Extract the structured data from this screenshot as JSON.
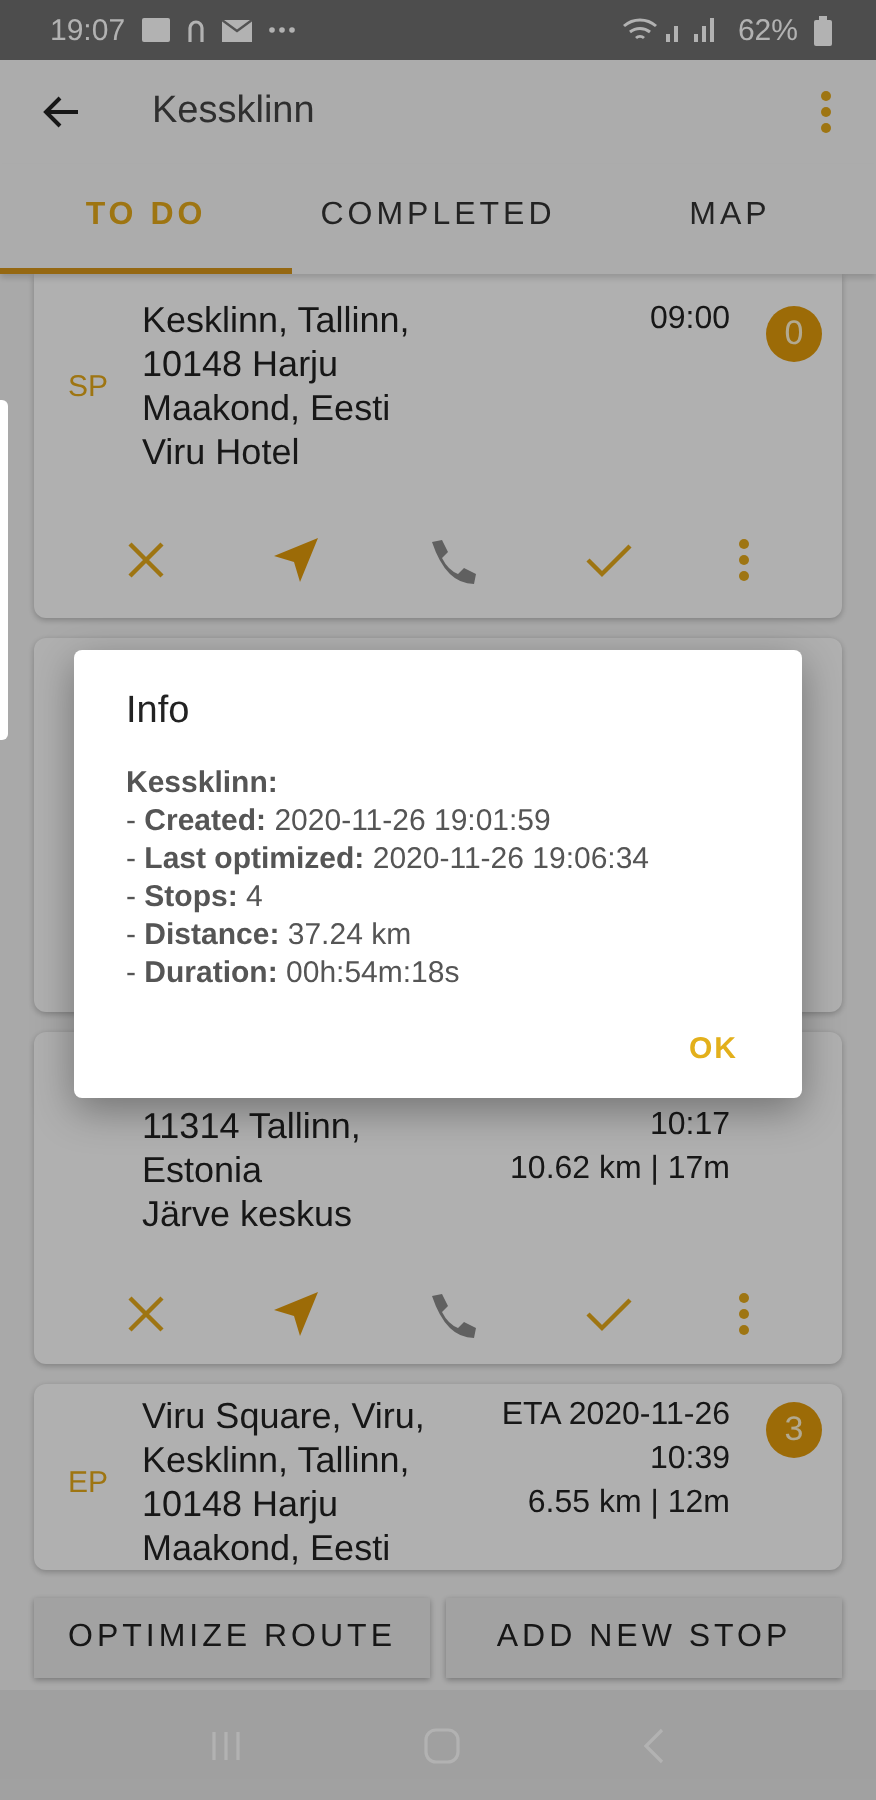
{
  "status_bar": {
    "time": "19:07",
    "battery": "62%"
  },
  "app_bar": {
    "title": "Kessklinn"
  },
  "tabs": [
    {
      "label": "TO DO",
      "selected": true
    },
    {
      "label": "COMPLETED",
      "selected": false
    },
    {
      "label": "MAP",
      "selected": false
    }
  ],
  "stops": [
    {
      "kind": "stop",
      "tag": "SP",
      "lines": [
        "Kesklinn, Tallinn,",
        "10148 Harju",
        "Maakond, Eesti",
        "Viru Hotel"
      ],
      "info": [
        "09:00"
      ],
      "badge": "0",
      "phone_enabled": false
    },
    {
      "kind": "covered"
    },
    {
      "kind": "stop",
      "lines": [
        "11314 Tallinn,",
        "Estonia",
        "Järve keskus"
      ],
      "info": [
        "10:17",
        "10.62 km | 17m"
      ],
      "phone_enabled": false
    },
    {
      "kind": "stop",
      "tag": "EP",
      "lines": [
        "Viru Square, Viru,",
        "Kesklinn, Tallinn,",
        "10148 Harju",
        "Maakond, Eesti"
      ],
      "info": [
        "ETA 2020-11-26",
        "10:39",
        "6.55 km | 12m"
      ],
      "badge": "3"
    }
  ],
  "buttons": [
    "OPTIMIZE ROUTE",
    "ADD NEW STOP"
  ],
  "dialog": {
    "title": "Info",
    "heading": "Kessklinn:",
    "lines": [
      "- **Created:** 2020-11-26 19:01:59",
      "- **Last optimized:** 2020-11-26 19:06:34",
      "- **Stops:** 4",
      "- **Distance:** 37.24 km",
      "- **Duration:** 00h:54m:18s"
    ],
    "button": "OK"
  }
}
